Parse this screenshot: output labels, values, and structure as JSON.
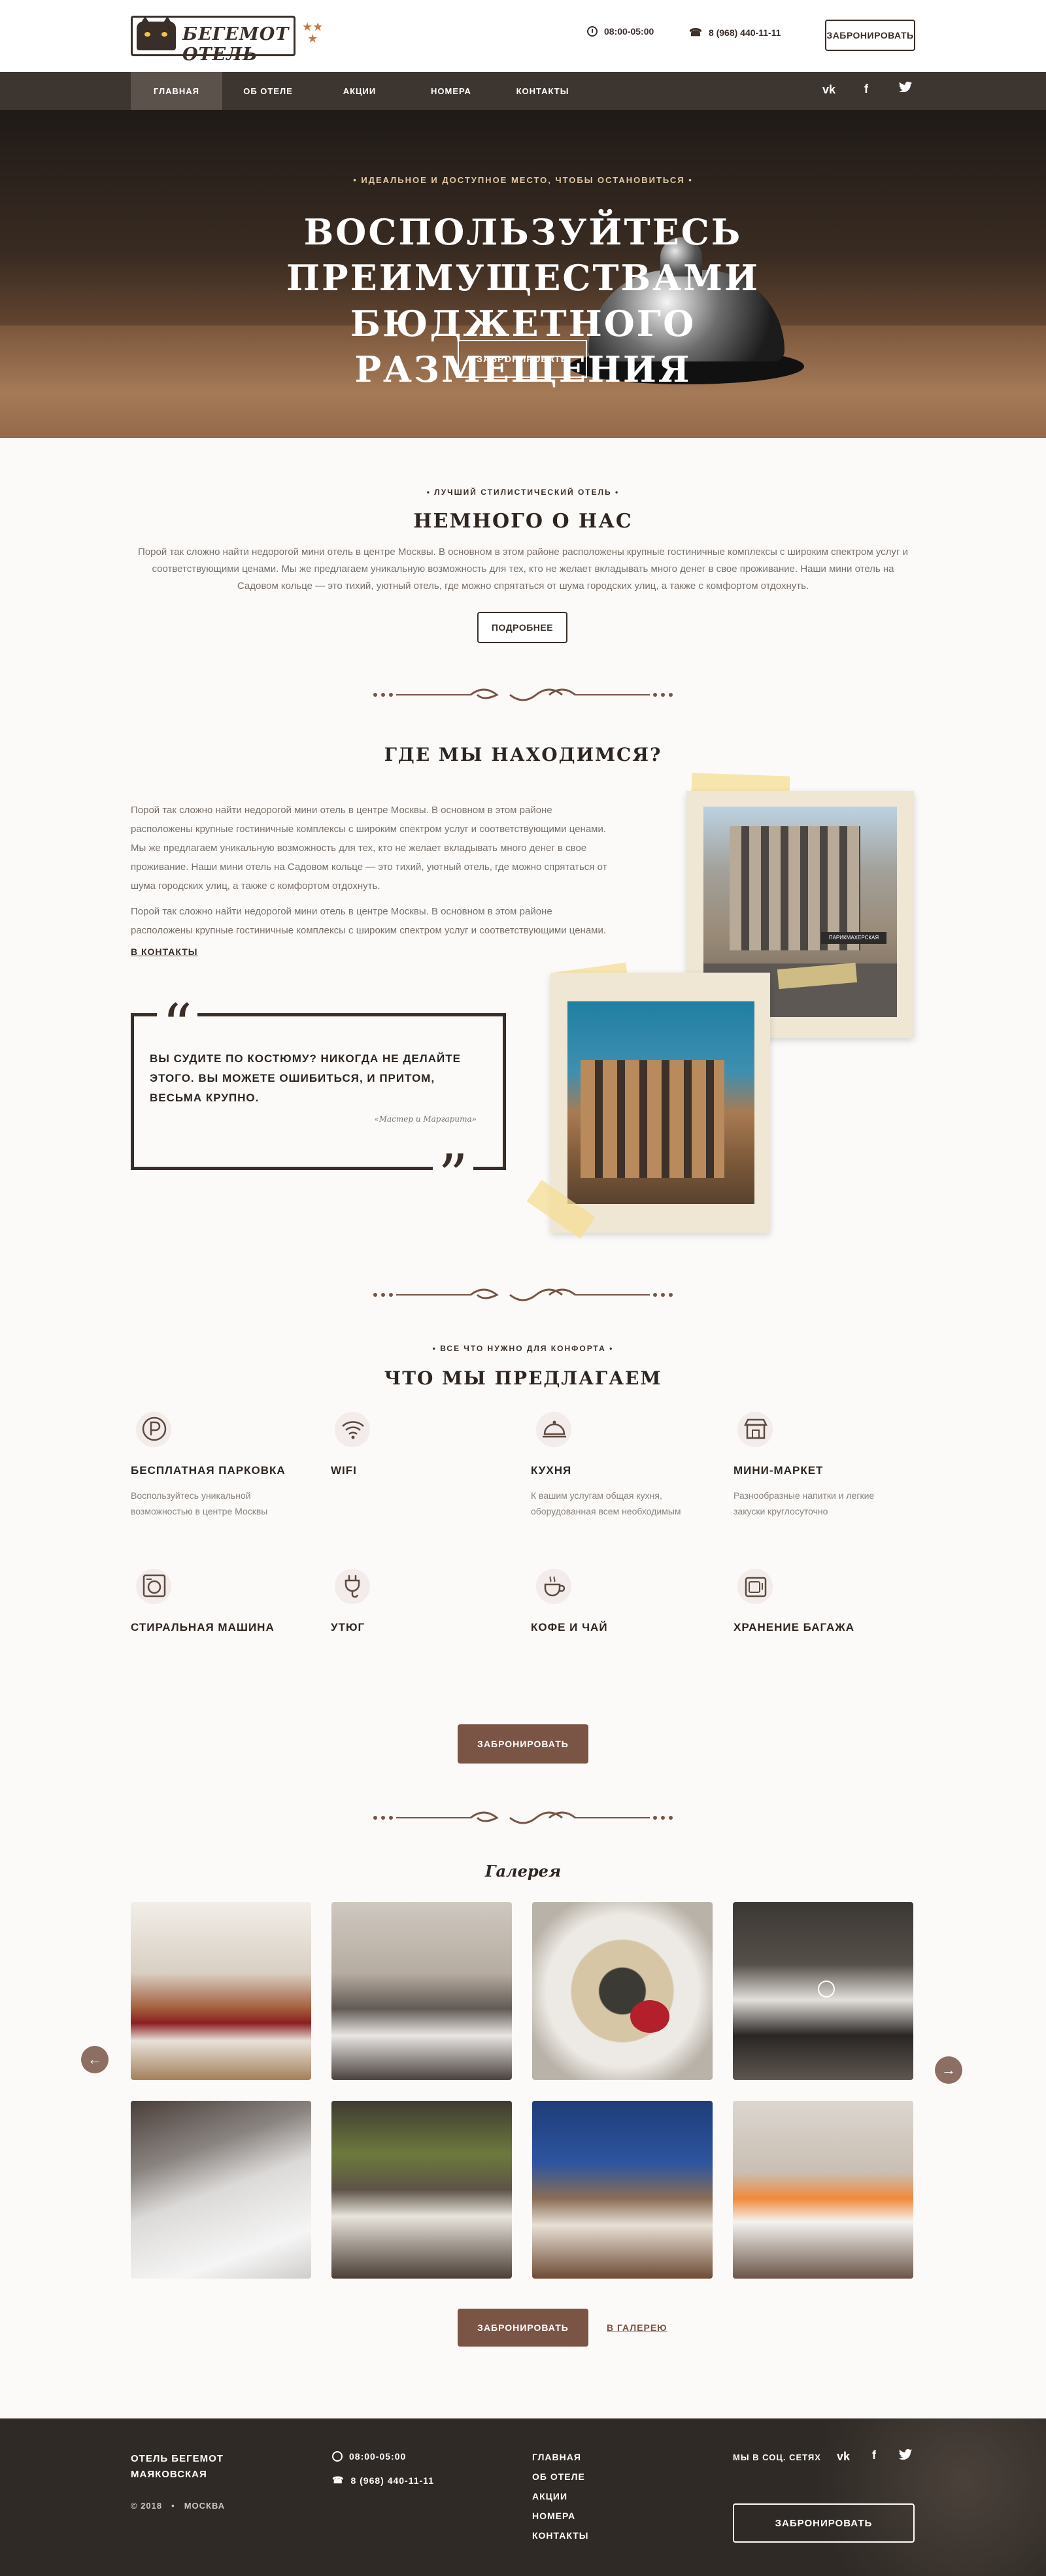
{
  "header": {
    "logo_text": "БЕГЕМОТ ОТЕЛЬ",
    "stars": "★★\n★",
    "hours": "08:00-05:00",
    "phone": "8 (968) 440-11-11",
    "book_label": "ЗАБРОНИРОВАТЬ"
  },
  "nav": {
    "items": [
      "ГЛАВНАЯ",
      "ОБ ОТЕЛЕ",
      "АКЦИИ",
      "НОМЕРА",
      "КОНТАКТЫ"
    ],
    "active": 0,
    "social": [
      "vk-icon",
      "facebook-icon",
      "twitter-icon"
    ]
  },
  "hero": {
    "subtitle": "• ИДЕАЛЬНОЕ И ДОСТУПНОЕ МЕСТО, ЧТОБЫ ОСТАНОВИТЬСЯ •",
    "title": "ВОСПОЛЬЗУЙТЕСЬ ПРЕИМУЩЕСТВАМИ БЮДЖЕТНОГО РАЗМЕЩЕНИЯ",
    "button": "ЗАБРОНИРОВАТЬ"
  },
  "about": {
    "kicker": "• ЛУЧШИЙ СТИЛИСТИЧЕСКИЙ ОТЕЛЬ •",
    "title": "НЕМНОГО О НАС",
    "text": "Порой так сложно найти недорогой мини отель в центре Москвы. В основном в этом районе расположены крупные гостиничные комплексы с широким спектром услуг и соответствующими ценами. Мы же предлагаем уникальную возможность для тех, кто не желает вкладывать много денег в свое проживание. Наши мини отель на Садовом кольце — это тихий, уютный отель, где можно спрятаться от шума городских улиц, а также с комфортом отдохнуть.",
    "button": "ПОДРОБНЕЕ"
  },
  "location": {
    "title": "ГДЕ МЫ НАХОДИМСЯ?",
    "p1": "Порой так сложно найти недорогой мини отель в центре Москвы. В основном в этом районе расположены крупные гостиничные комплексы с широким спектром услуг и соответствующими ценами. Мы же предлагаем уникальную возможность для тех, кто не желает вкладывать много денег в свое проживание. Наши мини отель на Садовом кольце — это тихий, уютный отель, где можно спрятаться от шума городских улиц, а также с комфортом отдохнуть.",
    "p2": "Порой так сложно найти недорогой мини отель в центре Москвы. В основном в этом районе расположены крупные гостиничные комплексы с широким спектром услуг и соответствующими ценами.",
    "link": "В КОНТАКТЫ",
    "sign": "ПАРИКМАХЕРСКАЯ"
  },
  "quote": {
    "text": "ВЫ СУДИТЕ ПО КОСТЮМУ? НИКОГДА НЕ ДЕЛАЙТЕ ЭТОГО. ВЫ МОЖЕТЕ ОШИБИТЬСЯ, И ПРИТОМ, ВЕСЬМА КРУПНО.",
    "author": "«Мастер и Маргарита»"
  },
  "features": {
    "kicker": "• ВСЕ ЧТО НУЖНО ДЛЯ КОНФОРТА •",
    "title": "ЧТО МЫ ПРЕДЛАГАЕМ",
    "items": [
      {
        "title": "БЕСПЛАТНАЯ ПАРКОВКА",
        "text": "Воспользуйтесь уникальной возможностью в центре Москвы",
        "icon": "parking-icon"
      },
      {
        "title": "WIFI",
        "text": "",
        "icon": "wifi-icon"
      },
      {
        "title": "КУХНЯ",
        "text": "К вашим услугам общая кухня, оборудованная всем необходимым",
        "icon": "cloche-icon"
      },
      {
        "title": "МИНИ-МАРКЕТ",
        "text": "Разнообразные напитки и легкие закуски круглосуточно",
        "icon": "shop-icon"
      },
      {
        "title": "СТИРАЛЬНАЯ МАШИНА",
        "text": "",
        "icon": "washing-machine-icon"
      },
      {
        "title": "УТЮГ",
        "text": "",
        "icon": "plug-icon"
      },
      {
        "title": "КОФЕ И ЧАЙ",
        "text": "",
        "icon": "coffee-icon"
      },
      {
        "title": "ХРАНЕНИЕ БАГАЖА",
        "text": "",
        "icon": "luggage-icon"
      }
    ],
    "button": "ЗАБРОНИРОВАТЬ"
  },
  "gallery": {
    "title": "Галерея",
    "button": "ЗАБРОНИРОВАТЬ",
    "link": "В ГАЛЕРЕЮ"
  },
  "footer": {
    "brand": "ОТЕЛЬ БЕГЕМОТ\nМАЯКОВСКАЯ",
    "copyright": "© 2018",
    "city": "МОСКВА",
    "hours": "08:00-05:00",
    "phone": "8 (968) 440-11-11",
    "links": [
      "ГЛАВНАЯ",
      "ОБ ОТЕЛЕ",
      "АКЦИИ",
      "НОМЕРА",
      "КОНТАКТЫ"
    ],
    "social_label": "МЫ В СОЦ. СЕТЯХ",
    "button": "ЗАБРОНИРОВАТЬ"
  },
  "colors": {
    "accent": "#7a5444",
    "dark": "#3d3530",
    "star": "#c7743f"
  }
}
